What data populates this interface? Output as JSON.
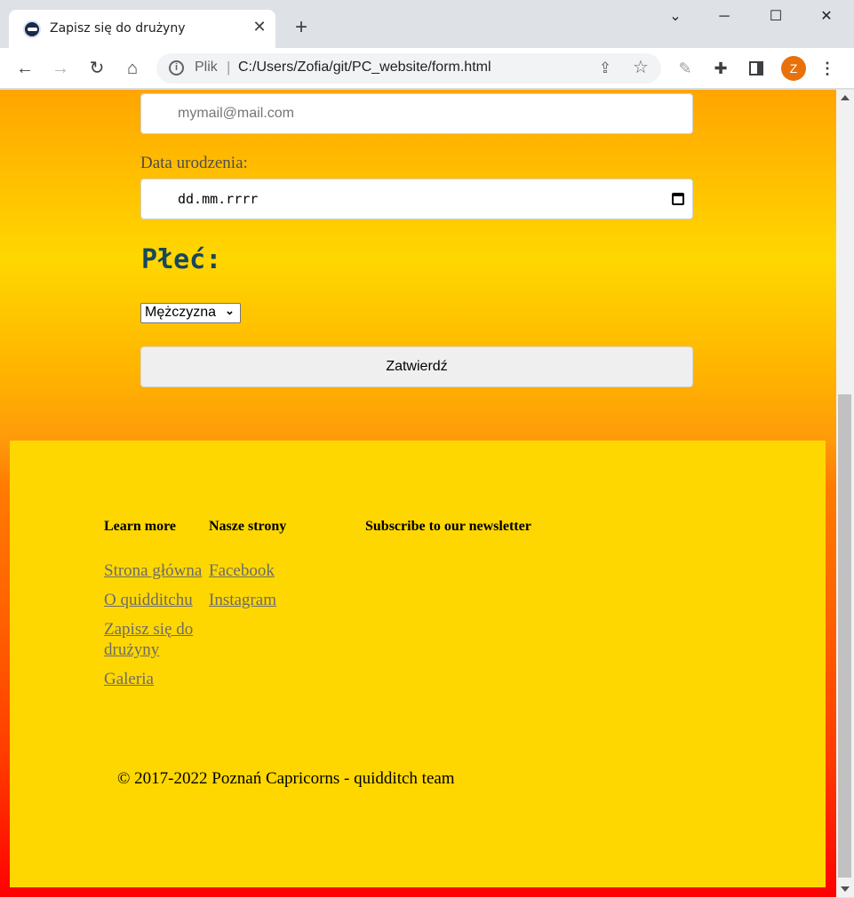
{
  "browser": {
    "tab_title": "Zapisz się do drużyny",
    "address_prefix": "Plik",
    "url": "C:/Users/Zofia/git/PC_website/form.html",
    "profile_initial": "Z"
  },
  "form": {
    "email_placeholder": "mymail@mail.com",
    "dob_label": "Data urodzenia:",
    "dob_value": "dd.mm.rrrr",
    "gender_heading": "Płeć:",
    "gender_selected": "Mężczyzna",
    "submit_label": "Zatwierdź"
  },
  "footer": {
    "columns": [
      {
        "heading": "Learn more",
        "links": [
          "Strona główna",
          "O quidditchu",
          "Zapisz się do drużyny",
          "Galeria"
        ]
      },
      {
        "heading": "Nasze strony",
        "links": [
          "Facebook",
          "Instagram"
        ]
      },
      {
        "heading": "Subscribe to our newsletter",
        "links": []
      }
    ],
    "copyright": "© 2017-2022 Poznań Capricorns - quidditch team"
  },
  "colors": {
    "footer_bg": "#ffd700",
    "heading_color": "#18465b",
    "link_color": "#6b6b6b"
  }
}
